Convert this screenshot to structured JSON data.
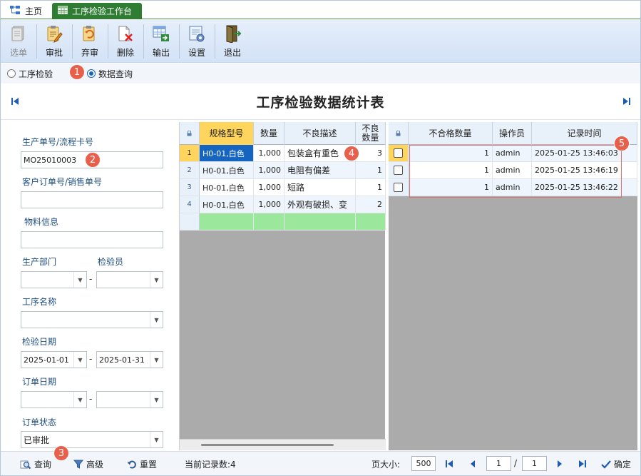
{
  "tabs": {
    "home": "主页",
    "active": "工序检验工作台"
  },
  "toolbar": {
    "select": "选单",
    "approve": "审批",
    "abandon": "弃审",
    "delete": "删除",
    "export": "输出",
    "settings": "设置",
    "exit": "退出"
  },
  "mode": {
    "process_inspection": "工序检验",
    "data_query": "数据查询"
  },
  "badges": [
    "1",
    "2",
    "3",
    "4",
    "5"
  ],
  "title": "工序检验数据统计表",
  "filter": {
    "order_no_label": "生产单号/流程卡号",
    "order_no_value": "MO25010003",
    "customer_order_label": "客户订单号/销售单号",
    "material_label": "物料信息",
    "department_label": "生产部门",
    "inspector_label": "检验员",
    "dash": "-",
    "process_label": "工序名称",
    "inspect_date_label": "检验日期",
    "inspect_date_from": "2025-01-01",
    "inspect_date_to": "2025-01-31",
    "order_date_label": "订单日期",
    "order_status_label": "订单状态",
    "order_status_value": "已审批"
  },
  "grid_left": {
    "headers": [
      "规格型号",
      "数量",
      "不良描述",
      "不良\n数量"
    ],
    "rows": [
      {
        "n": "1",
        "spec": "H0-01,白色",
        "qty": "1,000",
        "desc": "包装盒有重色",
        "bad": "3"
      },
      {
        "n": "2",
        "spec": "H0-01,白色",
        "qty": "1,000",
        "desc": "电阻有偏差",
        "bad": "1"
      },
      {
        "n": "3",
        "spec": "H0-01,白色",
        "qty": "1,000",
        "desc": "短路",
        "bad": "1"
      },
      {
        "n": "4",
        "spec": "H0-01,白色",
        "qty": "1,000",
        "desc": "外观有破损、变",
        "bad": "2"
      }
    ]
  },
  "grid_right": {
    "headers": [
      "不合格数量",
      "操作员",
      "记录时间"
    ],
    "rows": [
      {
        "qty": "1",
        "op": "admin",
        "time": "2025-01-25 13:46:03"
      },
      {
        "qty": "1",
        "op": "admin",
        "time": "2025-01-25 13:46:19"
      },
      {
        "qty": "1",
        "op": "admin",
        "time": "2025-01-25 13:46:22"
      }
    ]
  },
  "bottom": {
    "query": "查询",
    "advanced": "高级",
    "reset": "重置",
    "record_count": "当前记录数:4",
    "page_size_label": "页大小:",
    "page_size": "500",
    "page": "1",
    "slash": "/",
    "total_pages": "1",
    "confirm": "确定"
  },
  "colors": {
    "tab_active": "#2e7d32",
    "selected_header": "#ffd55e",
    "focus_cell": "#1565c0",
    "new_row": "#9be79b",
    "badge": "#e8604c"
  }
}
